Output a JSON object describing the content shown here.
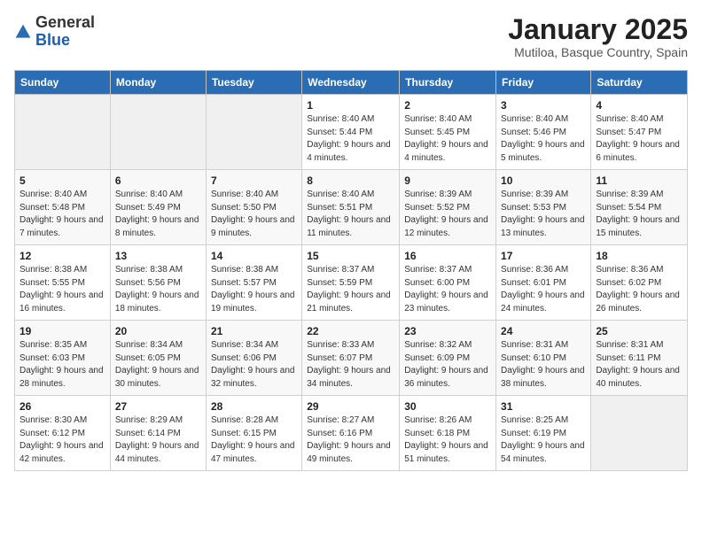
{
  "logo": {
    "general": "General",
    "blue": "Blue"
  },
  "title": "January 2025",
  "subtitle": "Mutiloa, Basque Country, Spain",
  "days_of_week": [
    "Sunday",
    "Monday",
    "Tuesday",
    "Wednesday",
    "Thursday",
    "Friday",
    "Saturday"
  ],
  "weeks": [
    [
      {
        "day": "",
        "info": ""
      },
      {
        "day": "",
        "info": ""
      },
      {
        "day": "",
        "info": ""
      },
      {
        "day": "1",
        "info": "Sunrise: 8:40 AM\nSunset: 5:44 PM\nDaylight: 9 hours and 4 minutes."
      },
      {
        "day": "2",
        "info": "Sunrise: 8:40 AM\nSunset: 5:45 PM\nDaylight: 9 hours and 4 minutes."
      },
      {
        "day": "3",
        "info": "Sunrise: 8:40 AM\nSunset: 5:46 PM\nDaylight: 9 hours and 5 minutes."
      },
      {
        "day": "4",
        "info": "Sunrise: 8:40 AM\nSunset: 5:47 PM\nDaylight: 9 hours and 6 minutes."
      }
    ],
    [
      {
        "day": "5",
        "info": "Sunrise: 8:40 AM\nSunset: 5:48 PM\nDaylight: 9 hours and 7 minutes."
      },
      {
        "day": "6",
        "info": "Sunrise: 8:40 AM\nSunset: 5:49 PM\nDaylight: 9 hours and 8 minutes."
      },
      {
        "day": "7",
        "info": "Sunrise: 8:40 AM\nSunset: 5:50 PM\nDaylight: 9 hours and 9 minutes."
      },
      {
        "day": "8",
        "info": "Sunrise: 8:40 AM\nSunset: 5:51 PM\nDaylight: 9 hours and 11 minutes."
      },
      {
        "day": "9",
        "info": "Sunrise: 8:39 AM\nSunset: 5:52 PM\nDaylight: 9 hours and 12 minutes."
      },
      {
        "day": "10",
        "info": "Sunrise: 8:39 AM\nSunset: 5:53 PM\nDaylight: 9 hours and 13 minutes."
      },
      {
        "day": "11",
        "info": "Sunrise: 8:39 AM\nSunset: 5:54 PM\nDaylight: 9 hours and 15 minutes."
      }
    ],
    [
      {
        "day": "12",
        "info": "Sunrise: 8:38 AM\nSunset: 5:55 PM\nDaylight: 9 hours and 16 minutes."
      },
      {
        "day": "13",
        "info": "Sunrise: 8:38 AM\nSunset: 5:56 PM\nDaylight: 9 hours and 18 minutes."
      },
      {
        "day": "14",
        "info": "Sunrise: 8:38 AM\nSunset: 5:57 PM\nDaylight: 9 hours and 19 minutes."
      },
      {
        "day": "15",
        "info": "Sunrise: 8:37 AM\nSunset: 5:59 PM\nDaylight: 9 hours and 21 minutes."
      },
      {
        "day": "16",
        "info": "Sunrise: 8:37 AM\nSunset: 6:00 PM\nDaylight: 9 hours and 23 minutes."
      },
      {
        "day": "17",
        "info": "Sunrise: 8:36 AM\nSunset: 6:01 PM\nDaylight: 9 hours and 24 minutes."
      },
      {
        "day": "18",
        "info": "Sunrise: 8:36 AM\nSunset: 6:02 PM\nDaylight: 9 hours and 26 minutes."
      }
    ],
    [
      {
        "day": "19",
        "info": "Sunrise: 8:35 AM\nSunset: 6:03 PM\nDaylight: 9 hours and 28 minutes."
      },
      {
        "day": "20",
        "info": "Sunrise: 8:34 AM\nSunset: 6:05 PM\nDaylight: 9 hours and 30 minutes."
      },
      {
        "day": "21",
        "info": "Sunrise: 8:34 AM\nSunset: 6:06 PM\nDaylight: 9 hours and 32 minutes."
      },
      {
        "day": "22",
        "info": "Sunrise: 8:33 AM\nSunset: 6:07 PM\nDaylight: 9 hours and 34 minutes."
      },
      {
        "day": "23",
        "info": "Sunrise: 8:32 AM\nSunset: 6:09 PM\nDaylight: 9 hours and 36 minutes."
      },
      {
        "day": "24",
        "info": "Sunrise: 8:31 AM\nSunset: 6:10 PM\nDaylight: 9 hours and 38 minutes."
      },
      {
        "day": "25",
        "info": "Sunrise: 8:31 AM\nSunset: 6:11 PM\nDaylight: 9 hours and 40 minutes."
      }
    ],
    [
      {
        "day": "26",
        "info": "Sunrise: 8:30 AM\nSunset: 6:12 PM\nDaylight: 9 hours and 42 minutes."
      },
      {
        "day": "27",
        "info": "Sunrise: 8:29 AM\nSunset: 6:14 PM\nDaylight: 9 hours and 44 minutes."
      },
      {
        "day": "28",
        "info": "Sunrise: 8:28 AM\nSunset: 6:15 PM\nDaylight: 9 hours and 47 minutes."
      },
      {
        "day": "29",
        "info": "Sunrise: 8:27 AM\nSunset: 6:16 PM\nDaylight: 9 hours and 49 minutes."
      },
      {
        "day": "30",
        "info": "Sunrise: 8:26 AM\nSunset: 6:18 PM\nDaylight: 9 hours and 51 minutes."
      },
      {
        "day": "31",
        "info": "Sunrise: 8:25 AM\nSunset: 6:19 PM\nDaylight: 9 hours and 54 minutes."
      },
      {
        "day": "",
        "info": ""
      }
    ]
  ]
}
